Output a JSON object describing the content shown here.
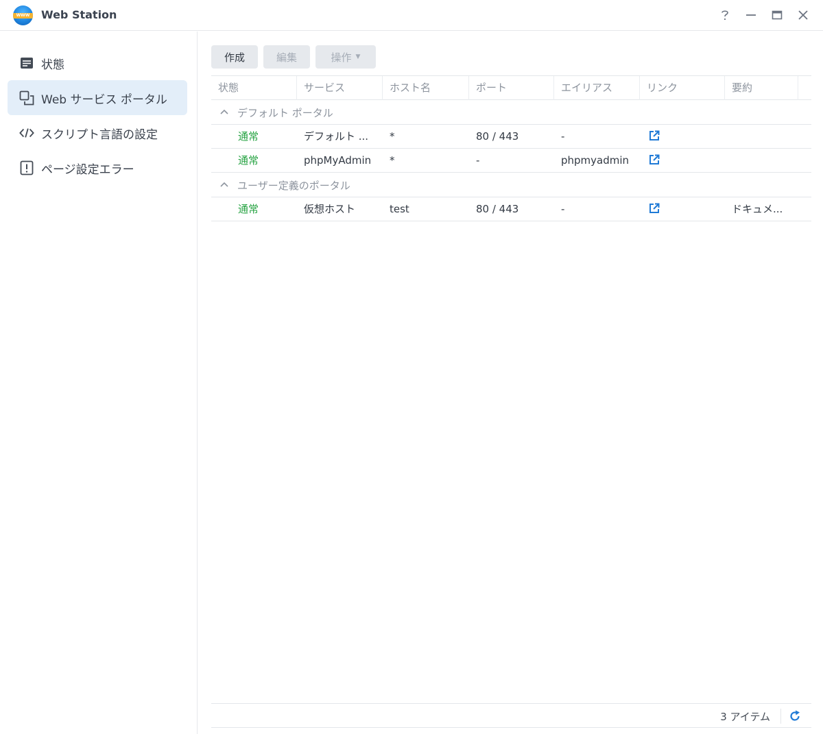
{
  "window": {
    "title": "Web Station",
    "logo_text": "WWW",
    "accent_color": "#1f7ad6",
    "status_ok_color": "#27a343"
  },
  "sidebar": {
    "items": [
      {
        "label": "状態",
        "icon": "status-list-icon",
        "active": false
      },
      {
        "label": "Web サービス ポータル",
        "icon": "portal-windows-icon",
        "active": true
      },
      {
        "label": "スクリプト言語の設定",
        "icon": "code-brackets-icon",
        "active": false
      },
      {
        "label": "ページ設定エラー",
        "icon": "exclamation-page-icon",
        "active": false
      }
    ]
  },
  "toolbar": {
    "create_label": "作成",
    "edit_label": "編集",
    "action_label": "操作"
  },
  "table": {
    "columns": [
      "状態",
      "サービス",
      "ホスト名",
      "ポート",
      "エイリアス",
      "リンク",
      "要約"
    ],
    "groups": [
      {
        "label": "デフォルト ポータル",
        "rows": [
          {
            "status": "通常",
            "service": "デフォルト ...",
            "host": "*",
            "port": "80 / 443",
            "alias": "-",
            "summary": ""
          },
          {
            "status": "通常",
            "service": "phpMyAdmin",
            "host": "*",
            "port": "-",
            "alias": "phpmyadmin",
            "summary": ""
          }
        ]
      },
      {
        "label": "ユーザー定義のポータル",
        "rows": [
          {
            "status": "通常",
            "service": "仮想ホスト",
            "host": "test",
            "port": "80 / 443",
            "alias": "-",
            "summary": "ドキュメ..."
          }
        ]
      }
    ]
  },
  "footer": {
    "item_count": "3 アイテム"
  }
}
